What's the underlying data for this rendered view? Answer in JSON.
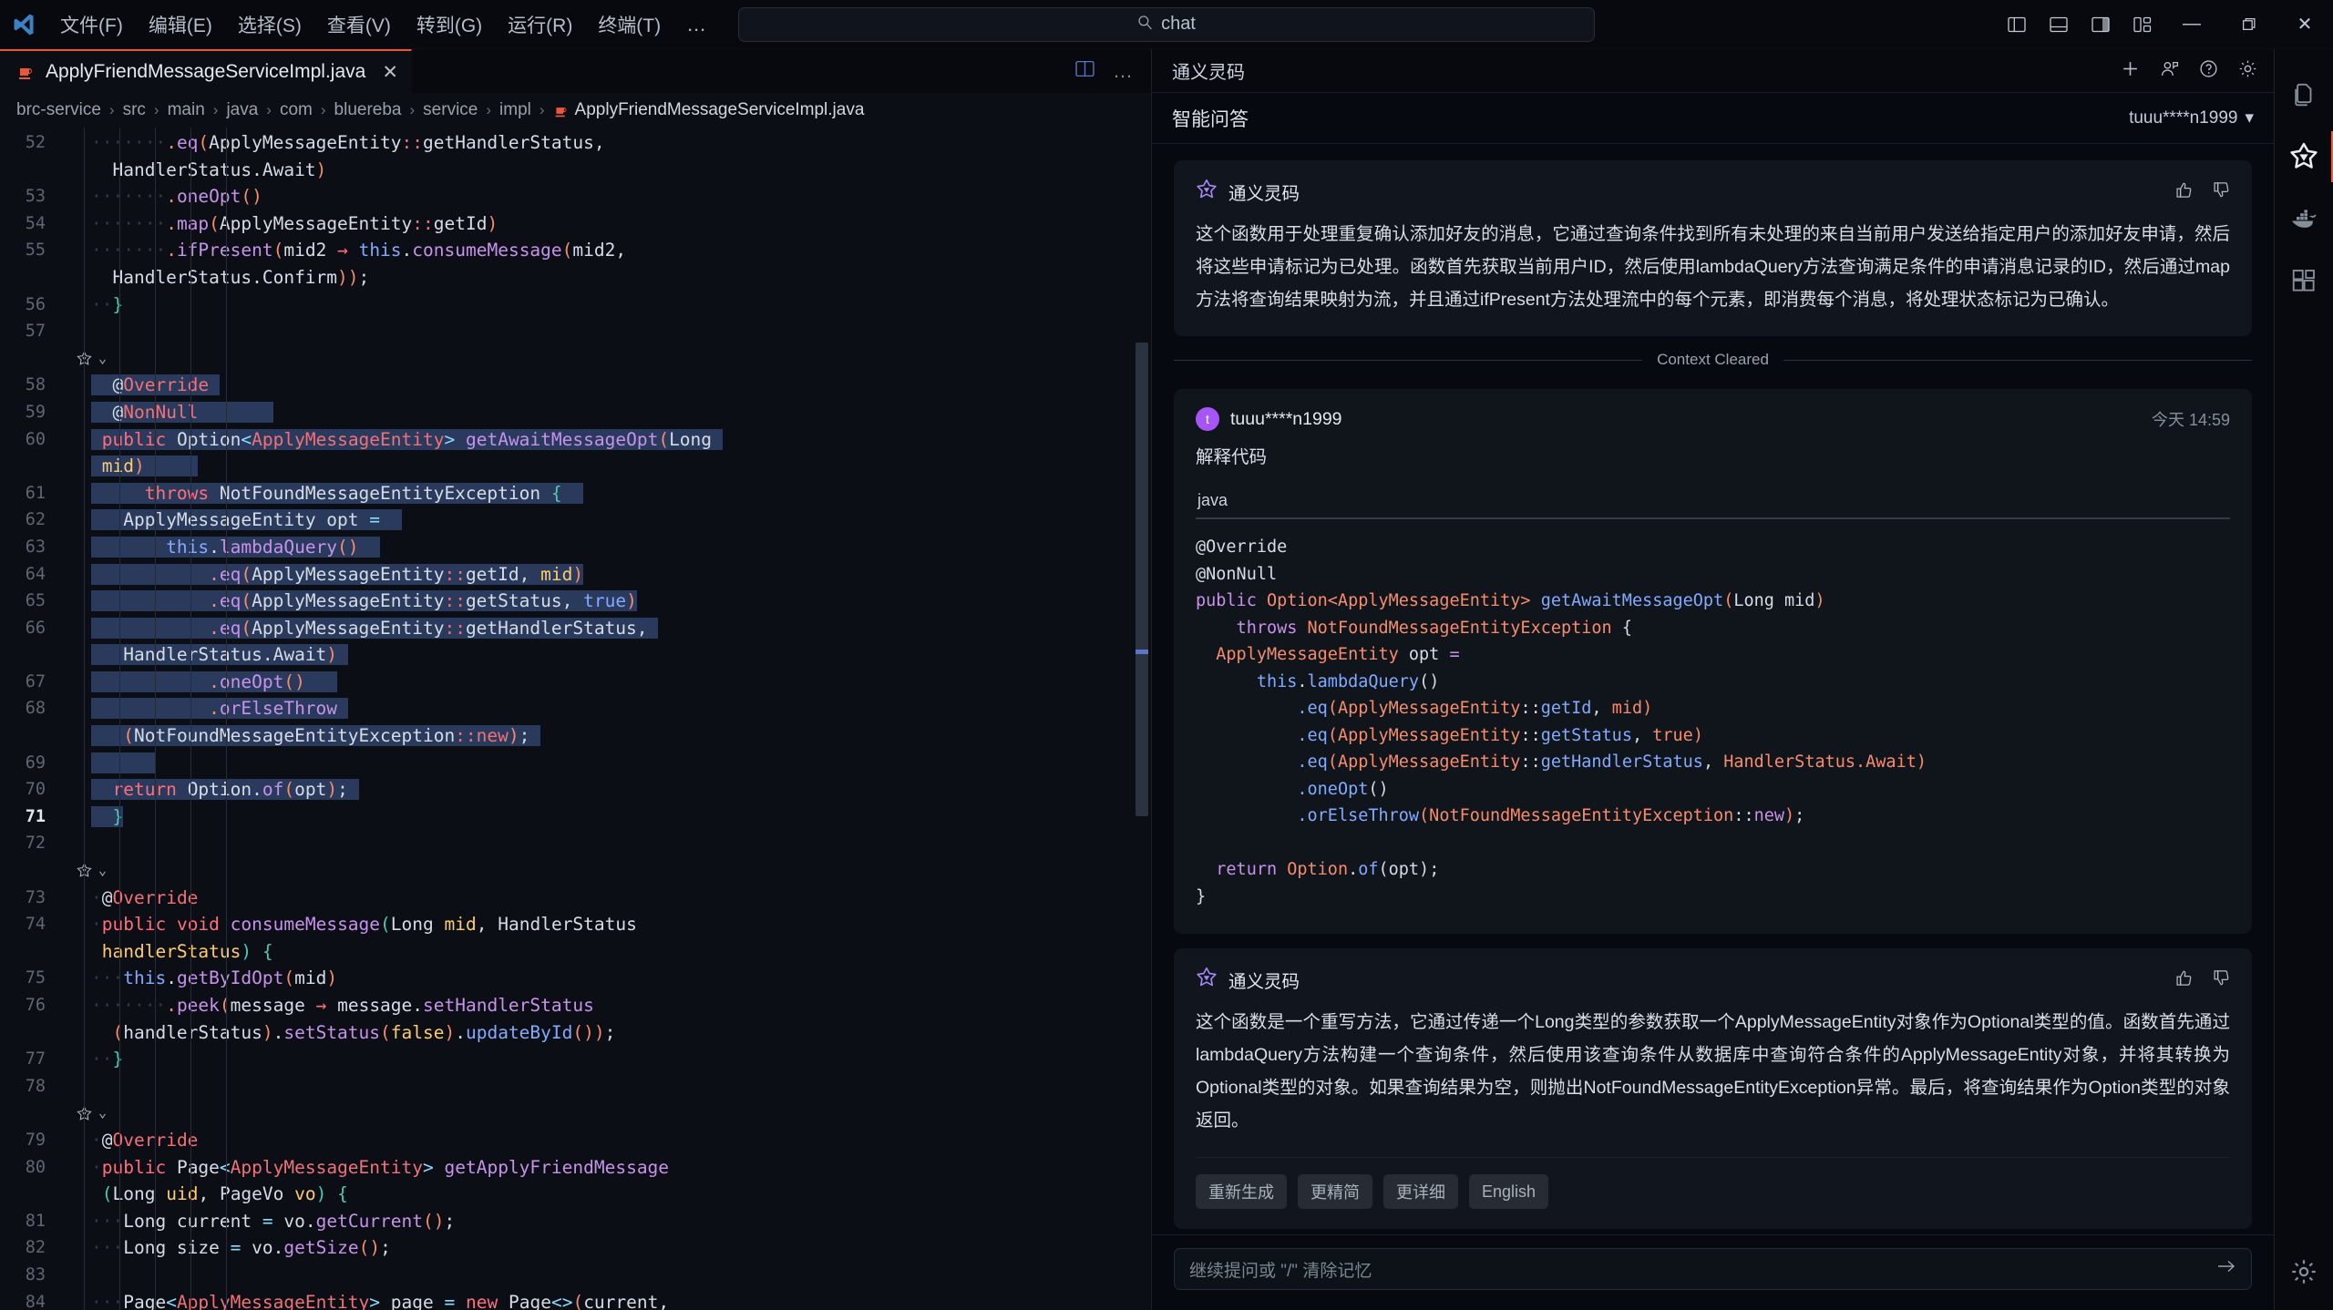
{
  "titlebar": {
    "logo_icon": "vscode-logo-icon",
    "menus": [
      {
        "label": "文件(F)",
        "name": "menu-file"
      },
      {
        "label": "编辑(E)",
        "name": "menu-edit"
      },
      {
        "label": "选择(S)",
        "name": "menu-selection"
      },
      {
        "label": "查看(V)",
        "name": "menu-view"
      },
      {
        "label": "转到(G)",
        "name": "menu-go"
      },
      {
        "label": "运行(R)",
        "name": "menu-run"
      },
      {
        "label": "终端(T)",
        "name": "menu-terminal"
      }
    ],
    "more_label": "…",
    "back_arrow": "←",
    "forward_arrow": "→",
    "search": {
      "value": "chat",
      "icon": "search-icon"
    },
    "layout_icons": [
      "toggle-primary-sidebar-icon",
      "toggle-panel-icon",
      "toggle-secondary-sidebar-icon",
      "customize-layout-icon"
    ],
    "window_controls": {
      "minimize": "—",
      "maximize": "❐",
      "close": "✕"
    }
  },
  "editor": {
    "tab": {
      "filename": "ApplyFriendMessageServiceImpl.java",
      "close": "✕",
      "icon": "java-file-icon"
    },
    "tab_actions": [
      "split-editor-icon",
      "more-actions-icon"
    ],
    "breadcrumbs": [
      {
        "label": "brc-service"
      },
      {
        "label": "src"
      },
      {
        "label": "main"
      },
      {
        "label": "java"
      },
      {
        "label": "com"
      },
      {
        "label": "bluereba"
      },
      {
        "label": "service"
      },
      {
        "label": "impl"
      },
      {
        "label": "ApplyFriendMessageServiceImpl.java",
        "icon": "java-file-icon"
      }
    ],
    "breadcrumb_separator": "›",
    "current_line": 71,
    "lines": [
      {
        "n": 52,
        "wrapped": true
      },
      {
        "n": 53
      },
      {
        "n": 54
      },
      {
        "n": 55,
        "wrapped": true
      },
      {
        "n": 56
      },
      {
        "n": 57
      },
      {
        "n": 58,
        "selected": true
      },
      {
        "n": 59,
        "selected": true
      },
      {
        "n": 60,
        "selected": true,
        "wrapped": true
      },
      {
        "n": 61,
        "selected": true
      },
      {
        "n": 62,
        "selected": true
      },
      {
        "n": 63,
        "selected": true
      },
      {
        "n": 64,
        "selected": true
      },
      {
        "n": 65,
        "selected": true
      },
      {
        "n": 66,
        "selected": true,
        "wrapped": true
      },
      {
        "n": 67,
        "selected": true
      },
      {
        "n": 68,
        "selected": true,
        "wrapped": true
      },
      {
        "n": 69,
        "selected": true
      },
      {
        "n": 70,
        "selected": true
      },
      {
        "n": 71,
        "selected": true
      },
      {
        "n": 72
      },
      {
        "n": 73
      },
      {
        "n": 74,
        "wrapped": true
      },
      {
        "n": 75
      },
      {
        "n": 76,
        "wrapped": true
      },
      {
        "n": 77
      },
      {
        "n": 78
      },
      {
        "n": 79
      },
      {
        "n": 80,
        "wrapped": true
      },
      {
        "n": 81
      },
      {
        "n": 82
      },
      {
        "n": 83
      },
      {
        "n": 84
      }
    ],
    "code_plain": ".eq(ApplyMessageEntity::getHandlerStatus, HandlerStatus.Await)\n.oneOpt()\n.map(ApplyMessageEntity::getId)\n.ifPresent(mid2 -> this.consumeMessage(mid2, HandlerStatus.Confirm));\n}\n\n@Override\n@NonNull\npublic Option<ApplyMessageEntity> getAwaitMessageOpt(Long mid)\n    throws NotFoundMessageEntityException {\n  ApplyMessageEntity opt =\n      this.lambdaQuery()\n          .eq(ApplyMessageEntity::getId, mid)\n          .eq(ApplyMessageEntity::getStatus, true)\n          .eq(ApplyMessageEntity::getHandlerStatus, HandlerStatus.Await)\n          .oneOpt()\n          .orElseThrow(NotFoundMessageEntityException::new);\n\n  return Option.of(opt);\n}\n\n@Override\npublic void consumeMessage(Long mid, HandlerStatus handlerStatus) {\n  this.getByIdOpt(mid)\n      .peek(message -> message.setHandlerStatus(handlerStatus).setStatus(false).updateById());\n}\n\n@Override\npublic Page<ApplyMessageEntity> getApplyFriendMessage(Long uid, PageVo vo) {\n  Long current = vo.getCurrent();\n  Long size = vo.getSize();\n\n  Page<ApplyMessageEntity> page = new Page<>(current,"
  },
  "chat": {
    "header": {
      "title": "通义灵码",
      "icons": [
        "new-chat-icon",
        "chat-history-icon",
        "help-icon",
        "settings-gear-icon"
      ]
    },
    "subbar": {
      "title": "智能问答",
      "account": "tuuu****n1999",
      "chevron": "▾"
    },
    "messages": [
      {
        "type": "assistant",
        "name": "通义灵码",
        "avatar_icon": "tongyi-lingma-logo-icon",
        "actions": [
          "thumbs-up-icon",
          "thumbs-down-icon"
        ],
        "text": "这个函数用于处理重复确认添加好友的消息，它通过查询条件找到所有未处理的来自当前用户发送给指定用户的添加好友申请，然后将这些申请标记为已处理。函数首先获取当前用户ID，然后使用lambdaQuery方法查询满足条件的申请消息记录的ID，然后通过map方法将查询结果映射为流，并且通过ifPresent方法处理流中的每个元素，即消费每个消息，将处理状态标记为已确认。"
      },
      {
        "type": "divider",
        "label": "Context Cleared"
      },
      {
        "type": "user",
        "name": "tuuu****n1999",
        "avatar_letter": "t",
        "time": "今天 14:59",
        "text": "解释代码",
        "code": {
          "lang": "java",
          "content": "@Override\n@NonNull\npublic Option<ApplyMessageEntity> getAwaitMessageOpt(Long mid)\n    throws NotFoundMessageEntityException {\n  ApplyMessageEntity opt =\n      this.lambdaQuery()\n          .eq(ApplyMessageEntity::getId, mid)\n          .eq(ApplyMessageEntity::getStatus, true)\n          .eq(ApplyMessageEntity::getHandlerStatus, HandlerStatus.Await)\n          .oneOpt()\n          .orElseThrow(NotFoundMessageEntityException::new);\n\n  return Option.of(opt);\n}"
        }
      },
      {
        "type": "assistant",
        "name": "通义灵码",
        "avatar_icon": "tongyi-lingma-logo-icon",
        "actions": [
          "thumbs-up-icon",
          "thumbs-down-icon"
        ],
        "text": "这个函数是一个重写方法，它通过传递一个Long类型的参数获取一个ApplyMessageEntity对象作为Optional类型的值。函数首先通过lambdaQuery方法构建一个查询条件，然后使用该查询条件从数据库中查询符合条件的ApplyMessageEntity对象，并将其转换为Optional类型的对象。如果查询结果为空，则抛出NotFoundMessageEntityException异常。最后，将查询结果作为Option类型的对象返回。",
        "quick_actions": [
          "重新生成",
          "更精简",
          "更详细",
          "English"
        ]
      }
    ],
    "input": {
      "placeholder": "继续提问或 \"/\" 清除记忆",
      "send_icon": "send-arrow-icon"
    }
  },
  "activitybar": {
    "items": [
      {
        "name": "explorer-files-icon",
        "active": false
      },
      {
        "name": "tongyi-lingma-icon",
        "active": true
      },
      {
        "name": "docker-icon",
        "active": false
      },
      {
        "name": "extensions-icon",
        "active": false
      }
    ],
    "bottom": [
      {
        "name": "manage-settings-gear-icon",
        "active": false
      }
    ]
  },
  "colors": {
    "accent": "#f05c3c",
    "selection": "#2a3a5c",
    "avatar": "#a855f7",
    "background": "#0b0e14"
  }
}
